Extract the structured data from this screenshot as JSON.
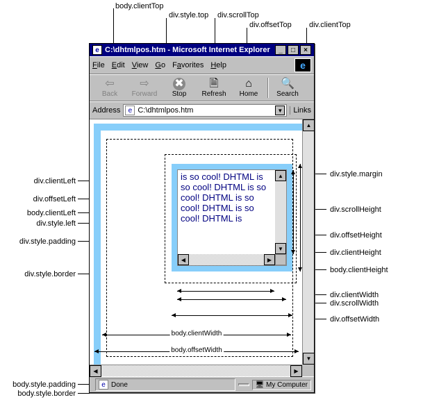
{
  "window": {
    "title": "C:\\dhtmlpos.htm - Microsoft Internet Explorer",
    "btn_min": "_",
    "btn_max": "□",
    "btn_close": "×"
  },
  "menu": {
    "file": "File",
    "edit": "Edit",
    "view": "View",
    "go": "Go",
    "favorites": "Favorites",
    "help": "Help",
    "logo": "e"
  },
  "toolbar": {
    "back": "Back",
    "forward": "Forward",
    "stop": "Stop",
    "refresh": "Refresh",
    "home": "Home",
    "search": "Search",
    "back_icon": "⇦",
    "forward_icon": "⇨",
    "stop_icon": "✖",
    "refresh_icon": "🗎",
    "home_icon": "⌂",
    "search_icon": "🔍"
  },
  "addressbar": {
    "label": "Address",
    "value": "C:\\dhtmlpos.htm",
    "links": "Links",
    "dd": "▼"
  },
  "content": {
    "text": "is so cool! DHTML is so cool! DHTML is so cool! DHTML is so cool! DHTML is so cool! DHTML is"
  },
  "scroll": {
    "up": "▲",
    "down": "▼",
    "left": "◀",
    "right": "▶"
  },
  "status": {
    "done": "Done",
    "zone": "My Computer",
    "zone_icon": "🖥"
  },
  "callouts": {
    "top": {
      "body_clientTop": "body.clientTop",
      "div_style_top": "div.style.top",
      "div_scrollTop": "div.scrollTop",
      "div_offsetTop": "div.offsetTop",
      "div_clientTop": "div.clientTop"
    },
    "left": {
      "div_clientLeft": "div.clientLeft",
      "div_offsetLeft": "div.offsetLeft",
      "body_clientLeft": "body.clientLeft",
      "div_style_left": "div.style.left",
      "div_style_padding": "div.style.padding",
      "div_style_border": "div.style.border",
      "body_style_padding": "body.style.padding",
      "body_style_border": "body.style.border"
    },
    "right": {
      "div_style_margin": "div.style.margin",
      "div_scrollHeight": "div.scrollHeight",
      "div_offsetHeight": "div.offsetHeight",
      "div_clientHeight": "div.clientHeight",
      "body_clientHeight": "body.clientHeight",
      "div_clientWidth": "div.clientWidth",
      "div_scrollWidth": "div.scrollWidth",
      "div_offsetWidth": "div.offsetWidth"
    },
    "dims": {
      "body_clientWidth": "body.clientWidth",
      "body_offsetWidth": "body.offsetWidth"
    }
  }
}
